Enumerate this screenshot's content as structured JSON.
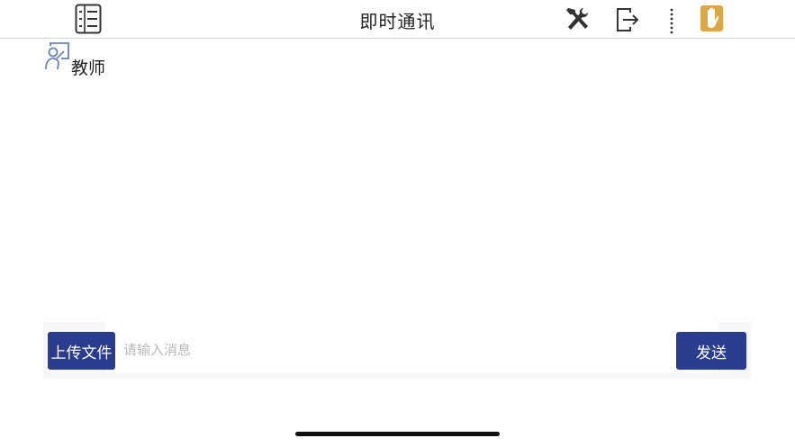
{
  "header": {
    "title": "即时通讯",
    "icons": {
      "menu": "list-menu-icon",
      "tools": "tools-icon",
      "logout": "logout-icon",
      "more": "more-vertical-icon",
      "hand": "raise-hand-icon"
    }
  },
  "participants": [
    {
      "role_label": "教师",
      "icon": "teacher-icon"
    }
  ],
  "composer": {
    "upload_label": "上传文件",
    "input_value": "",
    "input_placeholder": "请输入消息",
    "send_label": "发送"
  },
  "colors": {
    "primary": "#2a3c8e",
    "hand_button": "#d9a745",
    "teacher_icon": "#6a82b6"
  }
}
